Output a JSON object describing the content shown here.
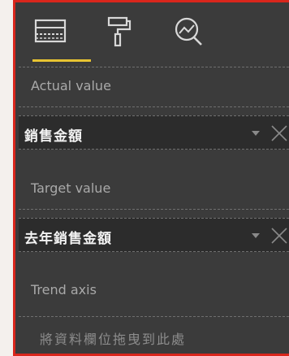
{
  "tabs": [
    {
      "name": "fields",
      "icon": "fields-icon",
      "active": true
    },
    {
      "name": "format",
      "icon": "paint-roller-icon",
      "active": false
    },
    {
      "name": "analytics",
      "icon": "analytics-icon",
      "active": false
    }
  ],
  "wells": {
    "actual": {
      "label": "Actual value",
      "field": "銷售金額"
    },
    "target": {
      "label": "Target value",
      "field": "去年銷售金額"
    },
    "trend": {
      "label": "Trend axis",
      "placeholder": "將資料欄位拖曳到此處"
    }
  },
  "colors": {
    "panel_bg": "#3b3b3b",
    "field_bg": "#2c2c2c",
    "highlight_border": "#d9261c",
    "active_tab_underline": "#e8c432"
  }
}
